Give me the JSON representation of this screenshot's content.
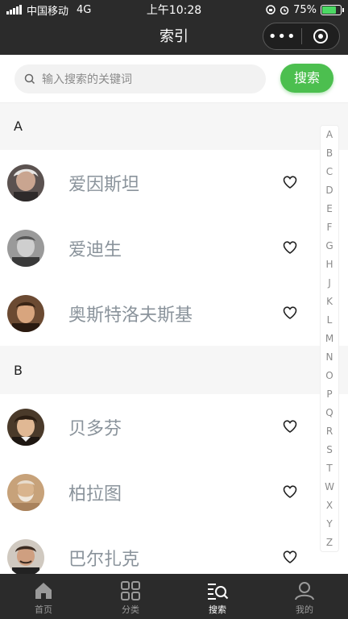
{
  "status": {
    "carrier": "中国移动",
    "network": "4G",
    "time": "上午10:28",
    "battery": "75%"
  },
  "navbar": {
    "title": "索引",
    "more": "•••"
  },
  "search": {
    "placeholder": "输入搜索的关键词",
    "button_label": "搜索"
  },
  "sections": [
    {
      "letter": "A",
      "items": [
        {
          "name": "爱因斯坦",
          "avatar": "einstein"
        },
        {
          "name": "爱迪生",
          "avatar": "edison"
        },
        {
          "name": "奥斯特洛夫斯基",
          "avatar": "ostrovsky"
        }
      ]
    },
    {
      "letter": "B",
      "items": [
        {
          "name": "贝多芬",
          "avatar": "beethoven"
        },
        {
          "name": "柏拉图",
          "avatar": "plato"
        },
        {
          "name": "巴尔扎克",
          "avatar": "balzac"
        }
      ]
    }
  ],
  "index_letters": [
    "A",
    "B",
    "C",
    "D",
    "E",
    "F",
    "G",
    "H",
    "J",
    "K",
    "L",
    "M",
    "N",
    "O",
    "P",
    "Q",
    "R",
    "S",
    "T",
    "W",
    "X",
    "Y",
    "Z"
  ],
  "tabs": [
    {
      "label": "首页",
      "icon": "home-icon"
    },
    {
      "label": "分类",
      "icon": "grid-icon"
    },
    {
      "label": "搜索",
      "icon": "search-list-icon",
      "active": true
    },
    {
      "label": "我的",
      "icon": "user-icon"
    }
  ],
  "colors": {
    "accent": "#4cbf4f",
    "bar": "#2b2b2b",
    "name_text": "#8a939b"
  }
}
